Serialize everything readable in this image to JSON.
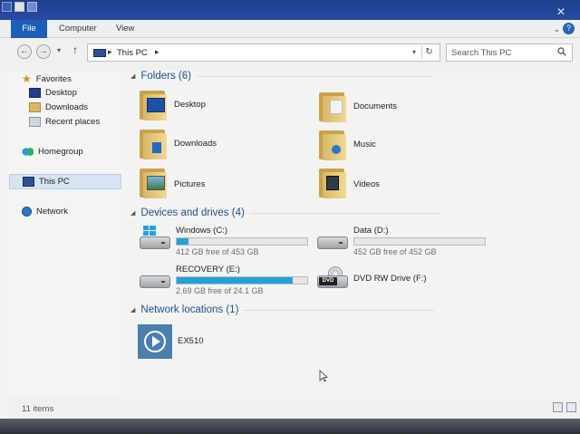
{
  "ribbon": {
    "tabs": [
      "File",
      "Computer",
      "View"
    ]
  },
  "address": {
    "crumb": "This PC",
    "search_placeholder": "Search This PC"
  },
  "navpane": {
    "favorites": "Favorites",
    "favorites_items": [
      "Desktop",
      "Downloads",
      "Recent places"
    ],
    "homegroup": "Homegroup",
    "this_pc": "This PC",
    "network": "Network"
  },
  "groups": {
    "folders": "Folders (6)",
    "devices": "Devices and drives (4)",
    "network": "Network locations (1)"
  },
  "folders": [
    "Desktop",
    "Documents",
    "Downloads",
    "Music",
    "Pictures",
    "Videos"
  ],
  "drives": [
    {
      "name": "Windows (C:)",
      "free": "412 GB free of 453 GB",
      "used_fraction": 0.09
    },
    {
      "name": "Data (D:)",
      "free": "452 GB free of 452 GB",
      "used_fraction": 0.0
    },
    {
      "name": "RECOVERY (E:)",
      "free": "2.69 GB free of 24.1 GB",
      "used_fraction": 0.89
    },
    {
      "name": "DVD RW Drive (F:)"
    }
  ],
  "network_locations": [
    "EX510"
  ],
  "status": {
    "count": "11 items"
  },
  "icons": {
    "dvd_badge": "DVD",
    "colors": {
      "accent": "#1c5fb8",
      "progress": "#26a0da",
      "group_header": "#1e4f8f"
    }
  }
}
